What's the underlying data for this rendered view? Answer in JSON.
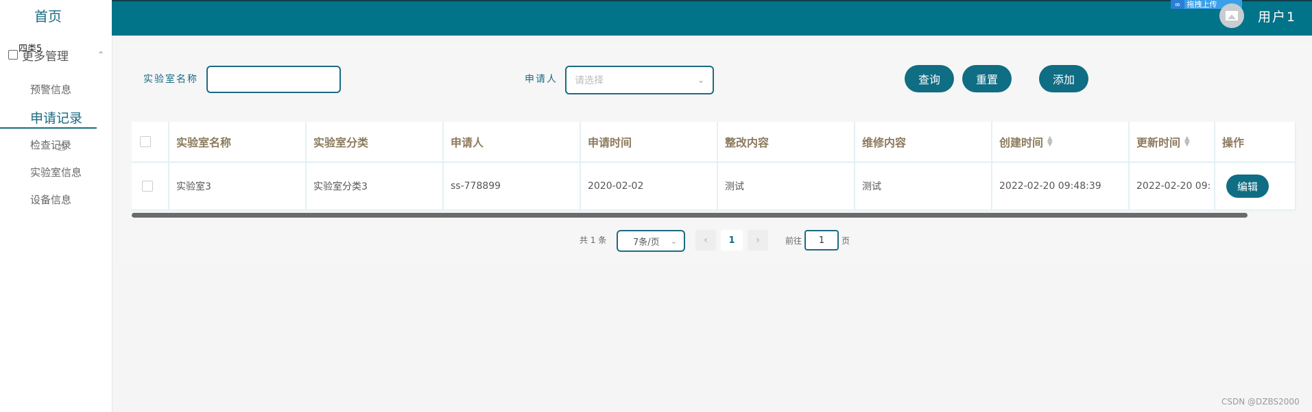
{
  "sidebar": {
    "home": "首页",
    "group_label": "更多管理",
    "overlay_text": "四类5",
    "items": [
      "预警信息",
      "申请记录",
      "检查记录",
      "实验室信息",
      "设备信息"
    ]
  },
  "header": {
    "badge_text": "拖拽上传",
    "username": "用户1"
  },
  "search": {
    "lab_name_label": "实验室名称",
    "applicant_label": "申请人",
    "applicant_placeholder": "请选择",
    "query_btn": "查询",
    "reset_btn": "重置",
    "add_btn": "添加"
  },
  "table": {
    "columns": [
      "实验室名称",
      "实验室分类",
      "申请人",
      "申请时间",
      "整改内容",
      "维修内容",
      "创建时间",
      "更新时间",
      "操作"
    ],
    "rows": [
      {
        "name": "实验室3",
        "category": "实验室分类3",
        "applicant": "ss-778899",
        "apply_time": "2020-02-02",
        "rectify": "测试",
        "repair": "测试",
        "created": "2022-02-20 09:48:39",
        "updated": "2022-02-20 09:",
        "edit": "编辑"
      }
    ]
  },
  "pagination": {
    "total": "共 1 条",
    "page_size": "7条/页",
    "prev": "‹",
    "current": "1",
    "next": "›",
    "goto_prefix": "前往",
    "goto_value": "1",
    "goto_suffix": "页"
  },
  "watermark": "CSDN @DZBS2000",
  "colors": {
    "primary": "#017489",
    "accent": "#0f6d84",
    "header_text": "#8c7a5d"
  }
}
